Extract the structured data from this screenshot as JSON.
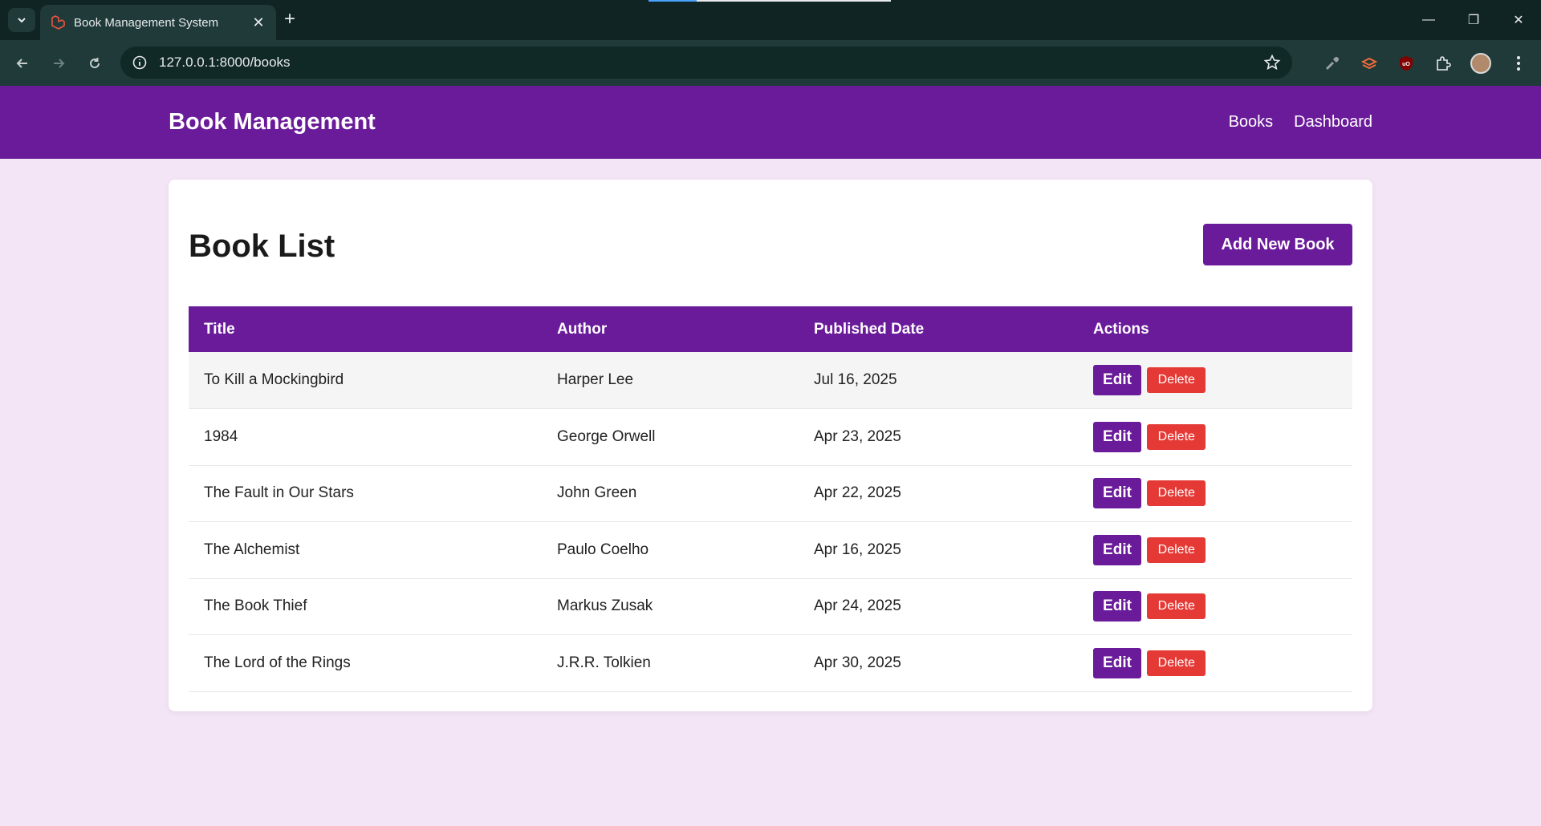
{
  "browser": {
    "tab_title": "Book Management System",
    "url": "127.0.0.1:8000/books"
  },
  "header": {
    "brand": "Book Management",
    "nav": [
      {
        "label": "Books"
      },
      {
        "label": "Dashboard"
      }
    ]
  },
  "main": {
    "title": "Book List",
    "add_button": "Add New Book",
    "table": {
      "columns": [
        "Title",
        "Author",
        "Published Date",
        "Actions"
      ],
      "rows": [
        {
          "title": "To Kill a Mockingbird",
          "author": "Harper Lee",
          "date": "Jul 16, 2025"
        },
        {
          "title": "1984",
          "author": "George Orwell",
          "date": "Apr 23, 2025"
        },
        {
          "title": "The Fault in Our Stars",
          "author": "John Green",
          "date": "Apr 22, 2025"
        },
        {
          "title": "The Alchemist",
          "author": "Paulo Coelho",
          "date": "Apr 16, 2025"
        },
        {
          "title": "The Book Thief",
          "author": "Markus Zusak",
          "date": "Apr 24, 2025"
        },
        {
          "title": "The Lord of the Rings",
          "author": "J.R.R. Tolkien",
          "date": "Apr 30, 2025"
        }
      ],
      "edit_label": "Edit",
      "delete_label": "Delete"
    }
  },
  "colors": {
    "primary": "#6a1b9a",
    "danger": "#e53935",
    "page_bg": "#f3e5f5"
  }
}
